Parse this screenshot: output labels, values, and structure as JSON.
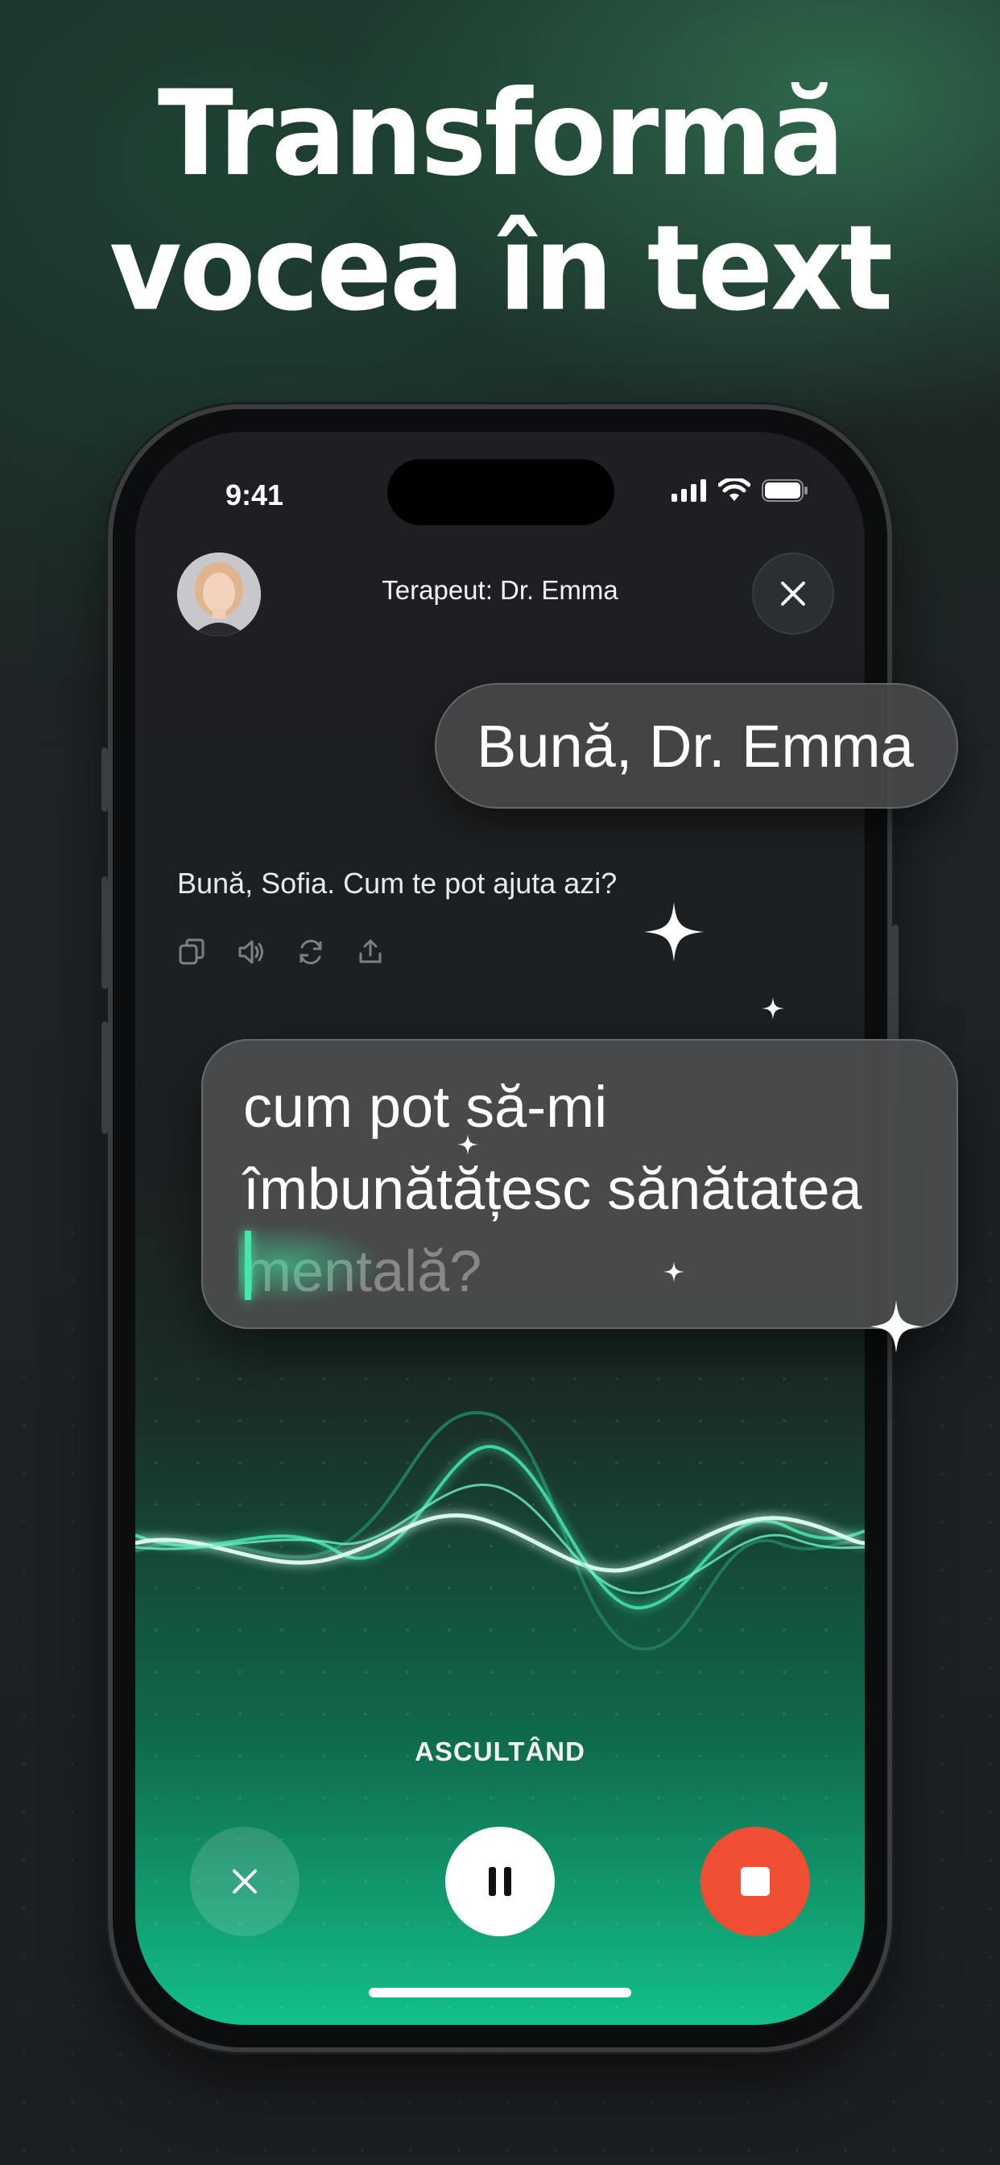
{
  "headline": {
    "line1": "Transformă",
    "line2": "vocea în text"
  },
  "status_bar": {
    "time": "9:41"
  },
  "header": {
    "title": "Terapeut: Dr. Emma"
  },
  "chat": {
    "user_bubble": "Bună, Dr. Emma",
    "assistant_message": "Bună, Sofia. Cum te pot ajuta azi?",
    "live_transcript": {
      "line1": "cum pot să-mi",
      "line2": "îmbunătățesc sănătatea",
      "line3_pending": "mentală?"
    }
  },
  "message_tools": [
    "copy-icon",
    "speaker-icon",
    "regenerate-icon",
    "share-icon"
  ],
  "recording": {
    "status": "ASCULTÂND"
  },
  "controls": {
    "cancel": "close-icon",
    "pause": "pause-icon",
    "stop": "stop-icon"
  },
  "colors": {
    "accent": "#13c08a",
    "stop": "#ef4e32",
    "wave": "#6ff0c4"
  }
}
